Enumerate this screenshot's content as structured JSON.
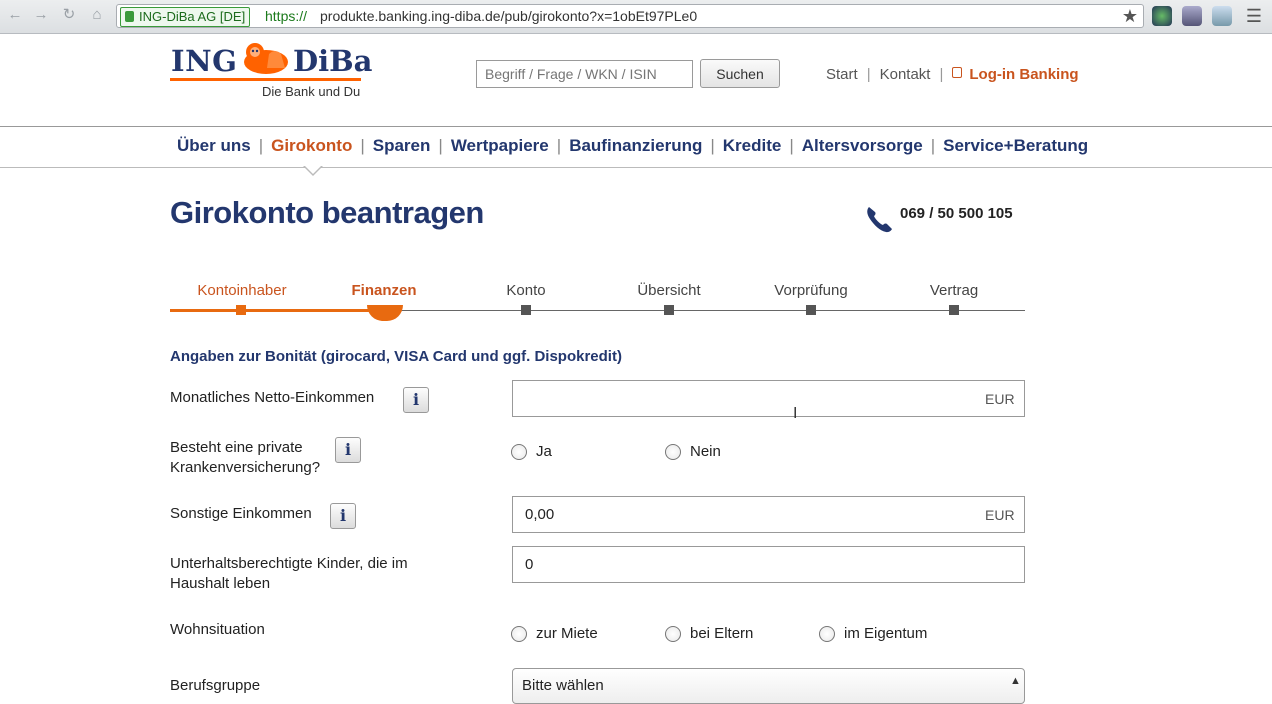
{
  "browser": {
    "ev_label": "ING-DiBa AG [DE]",
    "url_scheme": "https://",
    "url_rest": "produkte.banking.ing-diba.de/pub/girokonto?x=1obEt97PLe0"
  },
  "header": {
    "logo_ing": "ING",
    "logo_diba": "DiBa",
    "logo_tagline": "Die Bank und Du",
    "search_placeholder": "Begriff / Frage / WKN / ISIN",
    "search_button": "Suchen",
    "links": {
      "start": "Start",
      "kontakt": "Kontakt",
      "login": "Log-in Banking"
    },
    "separator": "|",
    "brand_color": "#23376e",
    "accent_color": "#ff6200"
  },
  "main_nav": {
    "items": [
      "Über uns",
      "Girokonto",
      "Sparen",
      "Wertpapiere",
      "Baufinanzierung",
      "Kredite",
      "Altersvorsorge",
      "Service+Beratung"
    ],
    "active": "Girokonto"
  },
  "page": {
    "title": "Girokonto beantragen",
    "phone": "069 / 50 500 105"
  },
  "steps": {
    "items": [
      "Kontoinhaber",
      "Finanzen",
      "Konto",
      "Übersicht",
      "Vorprüfung",
      "Vertrag"
    ],
    "active": "Finanzen"
  },
  "form": {
    "section_title": "Angaben zur Bonität (girocard, VISA Card und ggf. Dispokredit)",
    "info_glyph": "i",
    "netto": {
      "label": "Monatliches Netto-Einkommen",
      "value": "",
      "unit": "EUR"
    },
    "kranken": {
      "label_line1": "Besteht eine private",
      "label_line2": "Krankenversicherung?",
      "options": [
        "Ja",
        "Nein"
      ]
    },
    "sonstige": {
      "label": "Sonstige Einkommen",
      "value": "0,00",
      "unit": "EUR"
    },
    "kinder": {
      "label_line1": "Unterhaltsberechtigte Kinder, die im",
      "label_line2": "Haushalt leben",
      "value": "0"
    },
    "wohn": {
      "label": "Wohnsituation",
      "options": [
        "zur Miete",
        "bei Eltern",
        "im Eigentum"
      ]
    },
    "beruf": {
      "label": "Berufsgruppe",
      "selected": "Bitte wählen"
    }
  }
}
